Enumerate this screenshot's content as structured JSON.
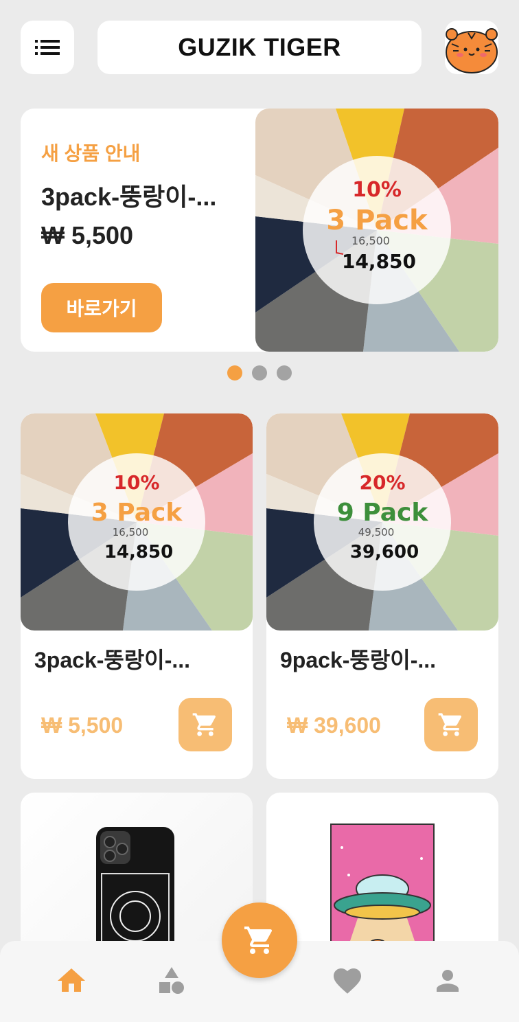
{
  "app": {
    "title": "GUZIK TIGER"
  },
  "header": {
    "menu_icon": "list-icon",
    "avatar_icon": "tiger-face-icon"
  },
  "banner": {
    "tag": "새 상품 안내",
    "name": "3pack-뚱랑이-...",
    "price": "₩ 5,500",
    "button_label": "바로가기",
    "image": {
      "discount": "10%",
      "pack": "3 Pack",
      "original": "16,500",
      "sale": "14,850"
    }
  },
  "carousel": {
    "count": 3,
    "active": 0
  },
  "products": [
    {
      "name": "3pack-뚱랑이-...",
      "price": "₩ 5,500",
      "image": {
        "discount": "10%",
        "pack": "3 Pack",
        "original": "16,500",
        "sale": "14,850"
      }
    },
    {
      "name": "9pack-뚱랑이-...",
      "price": "₩ 39,600",
      "image": {
        "discount": "20%",
        "pack": "9 Pack",
        "original": "49,500",
        "sale": "39,600"
      }
    }
  ],
  "colors": {
    "accent": "#f5a043",
    "accent_light": "#f7bd74",
    "background": "#ebebeb",
    "nav_icon": "#9e9e9e"
  },
  "nav": {
    "items": [
      "home-icon",
      "shapes-icon",
      "cart-icon",
      "heart-icon",
      "person-icon"
    ],
    "active": "home-icon"
  }
}
